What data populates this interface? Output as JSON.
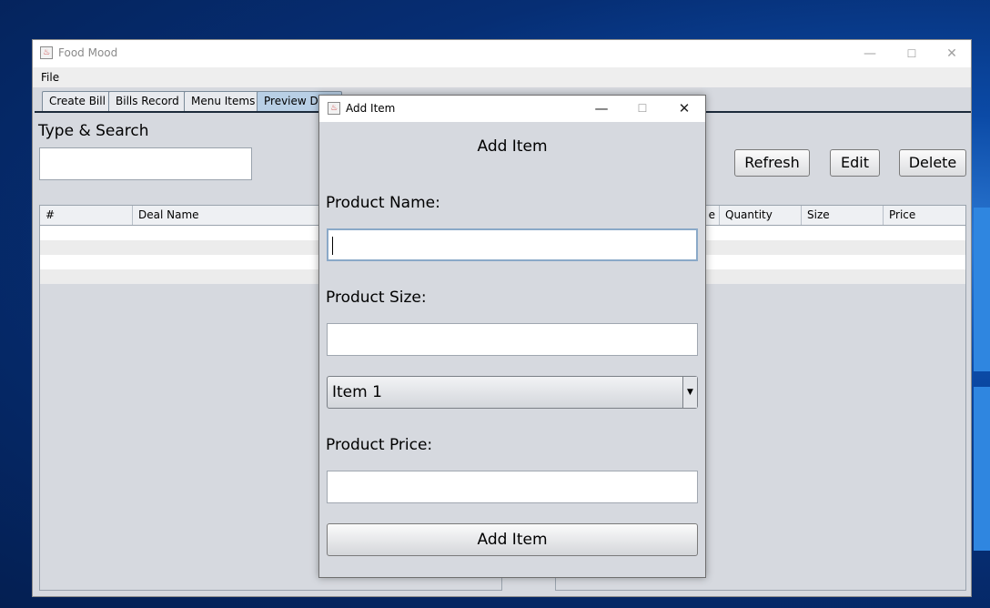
{
  "main_window": {
    "title": "Food Mood",
    "menu": {
      "file": "File"
    },
    "tabs": [
      {
        "label": "Create Bill"
      },
      {
        "label": "Bills Record"
      },
      {
        "label": "Menu Items"
      },
      {
        "label": "Preview De"
      }
    ],
    "search": {
      "label": "Type & Search",
      "value": ""
    },
    "buttons": {
      "refresh": "Refresh",
      "edit": "Edit",
      "delete": "Delete"
    },
    "left_table": {
      "columns": [
        "#",
        "Deal Name"
      ]
    },
    "right_table": {
      "columns": [
        "e",
        "Quantity",
        "Size",
        "Price"
      ]
    }
  },
  "dialog": {
    "title": "Add Item",
    "heading": "Add Item",
    "product_name_label": "Product Name:",
    "product_name_value": "",
    "product_size_label": "Product Size:",
    "product_size_value": "",
    "item_select_value": "Item 1",
    "product_price_label": "Product Price:",
    "product_price_value": "",
    "submit_label": "Add Item"
  },
  "colors": {
    "window_bg": "#d6d9df",
    "selected_tab": "#b8cfe5",
    "desktop_blue": "#0b4aa6"
  },
  "icons": [
    "java-app-icon",
    "minimize-icon",
    "maximize-icon",
    "close-icon",
    "dropdown-arrow-icon"
  ]
}
